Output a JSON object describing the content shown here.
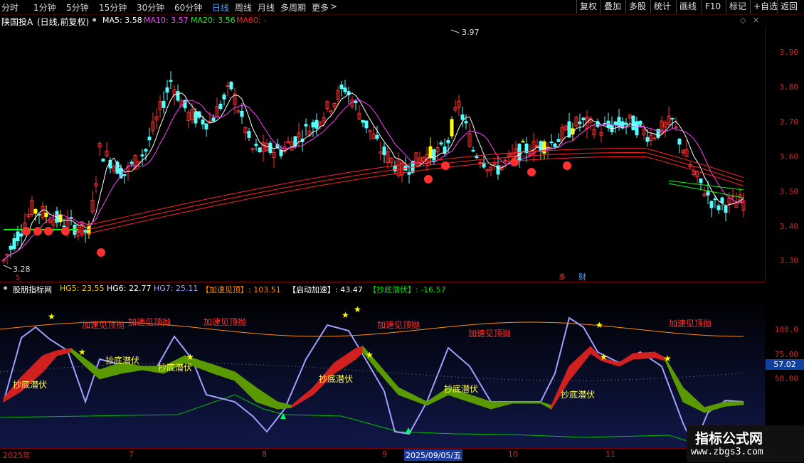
{
  "toolbar": {
    "timeframes": [
      "分时",
      "1分钟",
      "5分钟",
      "15分钟",
      "30分钟",
      "60分钟",
      "日线",
      "周线",
      "月线",
      "多周期",
      "更多"
    ],
    "active_timeframe": "日线",
    "more_chevron": ">",
    "right_buttons": [
      "复权",
      "叠加",
      "多股",
      "统计",
      "画线",
      "F10",
      "+自选",
      "返回"
    ],
    "mark_button": "标记",
    "back_icon": "‹"
  },
  "stock": {
    "title": "陕国投A",
    "mode": "(日线,前复权)",
    "ma5": "MA5: 3.58",
    "ma10": "MA10: 3.57",
    "ma20": "MA20: 3.56",
    "ma60": "MA60: -"
  },
  "price_axis": [
    "3.90",
    "3.80",
    "3.70",
    "3.60",
    "3.50",
    "3.40",
    "3.30"
  ],
  "high_label": "3.97",
  "low_label": "3.28",
  "bottom_marks": {
    "s1": "多",
    "s2": "财",
    "s3": "S"
  },
  "indicator": {
    "name": "股朋指标网",
    "hg5": "HG5: 23.55",
    "hg6": "HG6: 22.77",
    "hg7": "HG7: 25.11",
    "jsjd": "【加速见顶】: 103.51",
    "qdjs": "【启动加速】: 43.47",
    "cdqf": "【抄底潜伏】: -16.57",
    "axis": [
      "100.0",
      "75.00",
      "50.00"
    ],
    "current_value": "57.02",
    "text_top": "加速见顶抛",
    "text_bottom": "抄底潜伏"
  },
  "dates": [
    "2025年",
    "7",
    "8",
    "9",
    "2025/09/05/五",
    "10",
    "11"
  ],
  "watermark": {
    "line1": "指标公式网",
    "line2": "www.zbgs3.com"
  },
  "colors": {
    "up": "#ff3030",
    "down": "#54ffff",
    "yellow": "#ffff00",
    "ma5": "#ffffff",
    "ma10": "#ff40ff",
    "ma20": "#00ff00",
    "ma60": "#ff2020"
  }
}
